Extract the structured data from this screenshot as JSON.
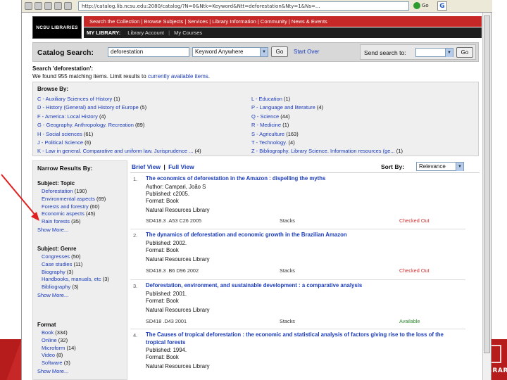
{
  "browser": {
    "url": "http://catalog.lib.ncsu.edu:2080/catalog/?N=0&Ntk=Keyword&Ntt=deforestation&Nty=1&Ns=...",
    "go_label": "Go"
  },
  "site": {
    "logo_text": "NCSU LIBRARIES",
    "top_nav": "Search the Collection | Browse Subjects | Services | Library Information | Community | News & Events",
    "my_library": "MY LIBRARY:",
    "sub_nav_items": [
      "Library Account",
      "My Courses"
    ]
  },
  "search": {
    "label": "Catalog Search:",
    "query": "deforestation",
    "field_select": "Keyword Anywhere",
    "go_label": "Go",
    "start_over": "Start Over",
    "send_label": "Send search to:",
    "send_go": "Go"
  },
  "summary": {
    "search_for_prefix": "Search '",
    "search_term": "deforestation",
    "search_for_suffix": "':",
    "found_text": "We found 955 matching items. Limit results to",
    "available_link": "currently available items",
    "found_suffix": "."
  },
  "browse": {
    "title": "Browse By:",
    "left": [
      {
        "label": "C - Auxiliary Sciences of History",
        "count": "(1)"
      },
      {
        "label": "D - History (General) and History of Europe",
        "count": "(5)"
      },
      {
        "label": "F - America: Local History",
        "count": "(4)"
      },
      {
        "label": "G - Geography. Anthropology. Recreation",
        "count": "(89)"
      },
      {
        "label": "H - Social sciences",
        "count": "(61)"
      },
      {
        "label": "J - Political Science",
        "count": "(6)"
      },
      {
        "label": "K - Law in general. Comparative and uniform law. Jurisprudence ...",
        "count": "(4)"
      }
    ],
    "right": [
      {
        "label": "L - Education",
        "count": "(1)"
      },
      {
        "label": "P - Language and literature",
        "count": "(4)"
      },
      {
        "label": "Q - Science",
        "count": "(44)"
      },
      {
        "label": "R - Medicine",
        "count": "(1)"
      },
      {
        "label": "S - Agriculture",
        "count": "(163)"
      },
      {
        "label": "T - Technology.",
        "count": "(4)"
      },
      {
        "label": "Z - Bibliography. Library Science. Information resources (ge...",
        "count": "(1)"
      }
    ]
  },
  "narrow": {
    "title": "Narrow Results By:",
    "topic_heading": "Subject: Topic",
    "topics": [
      {
        "label": "Deforestation",
        "count": "(190)"
      },
      {
        "label": "Environmental aspects",
        "count": "(69)"
      },
      {
        "label": "Forests and forestry",
        "count": "(60)"
      },
      {
        "label": "Economic aspects",
        "count": "(45)"
      },
      {
        "label": "Rain forests",
        "count": "(35)"
      }
    ],
    "topic_more": "Show More...",
    "genre_heading": "Subject: Genre",
    "genres": [
      {
        "label": "Congresses",
        "count": "(50)"
      },
      {
        "label": "Case studies",
        "count": "(11)"
      },
      {
        "label": "Biography",
        "count": "(3)"
      },
      {
        "label": "Handbooks, manuals, etc",
        "count": "(3)"
      },
      {
        "label": "Bibliography",
        "count": "(3)"
      }
    ],
    "genre_more": "Show More...",
    "format_heading": "Format",
    "formats": [
      {
        "label": "Book",
        "count": "(334)"
      },
      {
        "label": "Online",
        "count": "(32)"
      },
      {
        "label": "Microform",
        "count": "(14)"
      },
      {
        "label": "Video",
        "count": "(8)"
      },
      {
        "label": "Software",
        "count": "(3)"
      }
    ],
    "format_more": "Show More..."
  },
  "results": {
    "brief_view": "Brief View",
    "full_view": "Full View",
    "sort_label": "Sort By:",
    "sort_value": "Relevance",
    "items": [
      {
        "num": "1.",
        "title": "The economics of deforestation in the Amazon : dispelling the myths",
        "author": "Author: Campari, João S",
        "published": "Published: c2005.",
        "format": "Format: Book",
        "library": "Natural Resources Library",
        "call": "SD418.3 .A53 C26 2005",
        "location": "Stacks",
        "status": "Checked Out"
      },
      {
        "num": "2.",
        "title": "The dynamics of deforestation and economic growth in the Brazilian Amazon",
        "published": "Published: 2002.",
        "format": "Format: Book",
        "library": "Natural Resources Library",
        "call": "SD418.3 .B6 D96 2002",
        "location": "Stacks",
        "status": "Checked Out"
      },
      {
        "num": "3.",
        "title": "Deforestation, environment, and sustainable development : a comparative analysis",
        "published": "Published: 2001.",
        "format": "Format: Book",
        "library": "Natural Resources Library",
        "call": "SD418 .D43 2001",
        "location": "Stacks",
        "status": "Available"
      },
      {
        "num": "4.",
        "title": "The Causes of tropical deforestation : the economic and statistical analysis of factors giving rise to the loss of the tropical forests",
        "published": "Published: 1994.",
        "format": "Format: Book",
        "library": "Natural Resources Library"
      }
    ]
  },
  "slide": {
    "corner_logo_text": "LIBRARIES"
  },
  "colors": {
    "nav_red": "#c62828",
    "link_blue": "#1a3bbd",
    "status_out": "#d32f2f",
    "status_available": "#2e8b2e",
    "arrow_red": "#e02020"
  }
}
